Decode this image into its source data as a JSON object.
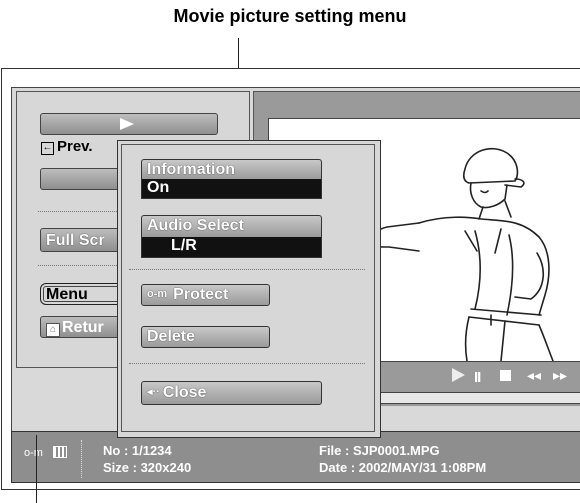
{
  "caption": {
    "top": "Movie picture setting menu"
  },
  "left_panel": {
    "prev_icon": "←",
    "prev_label": "Prev.",
    "full_screen_label": "Full Scr",
    "menu_label": "Menu",
    "return_label": "Retur"
  },
  "popup": {
    "information_label": "Information",
    "information_value": "On",
    "audio_select_label": "Audio Select",
    "audio_select_value": "L/R",
    "protect_label": "Protect",
    "delete_label": "Delete",
    "close_label": "Close",
    "close_icon_glyph": "◂··"
  },
  "player_controls": {
    "pause_glyph": "II",
    "rewind_glyph": "◂◂",
    "fast_forward_glyph": "▸▸"
  },
  "info_bar": {
    "no_text": "No   : 1/1234",
    "size_text": "Size : 320x240",
    "file_text": "File  : SJP0001.MPG",
    "date_text": "Date : 2002/MAY/31 1:08PM"
  },
  "icons": {
    "play": "play-icon",
    "prev": "prev-arrow-icon",
    "return": "home-icon",
    "protect": "key-icon",
    "close": "back-arrow-icon",
    "file_type": "film-icon"
  }
}
